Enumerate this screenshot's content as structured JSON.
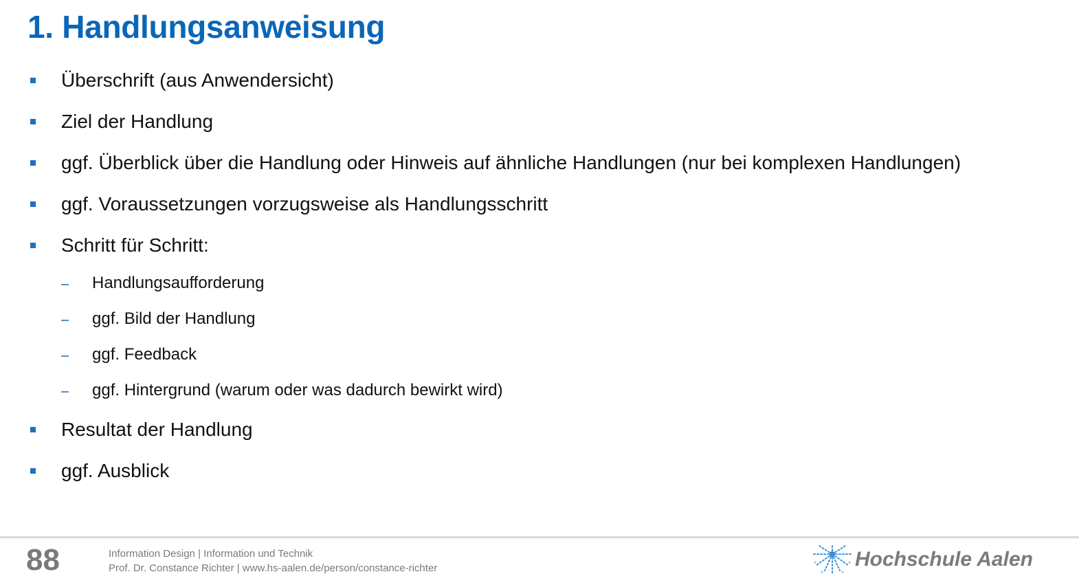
{
  "slide": {
    "title": "1. Handlungsanweisung"
  },
  "list": {
    "item1": "Überschrift (aus Anwendersicht)",
    "item2": "Ziel der Handlung",
    "item3": "ggf. Überblick über die Handlung oder Hinweis auf ähnliche Handlungen (nur bei komplexen Handlungen)",
    "item4": "ggf. Voraussetzungen vorzugsweise als Handlungsschritt",
    "item5": "Schritt für Schritt:",
    "sub1": "Handlungsaufforderung",
    "sub2": "ggf. Bild der Handlung",
    "sub3": "ggf. Feedback",
    "sub4": "ggf. Hintergrund (warum oder was dadurch bewirkt wird)",
    "item6": "Resultat der Handlung",
    "item7": "ggf. Ausblick"
  },
  "footer": {
    "page_number": "88",
    "line1": "Information Design | Information und Technik",
    "line2": "Prof. Dr. Constance Richter | www.hs-aalen.de/person/constance-richter",
    "logo_text": "Hochschule Aalen",
    "logo_icon": "starburst-icon"
  },
  "colors": {
    "title": "#0a66b8",
    "bullet": "#1f6fc0",
    "footer_text": "#7a7a7a"
  }
}
